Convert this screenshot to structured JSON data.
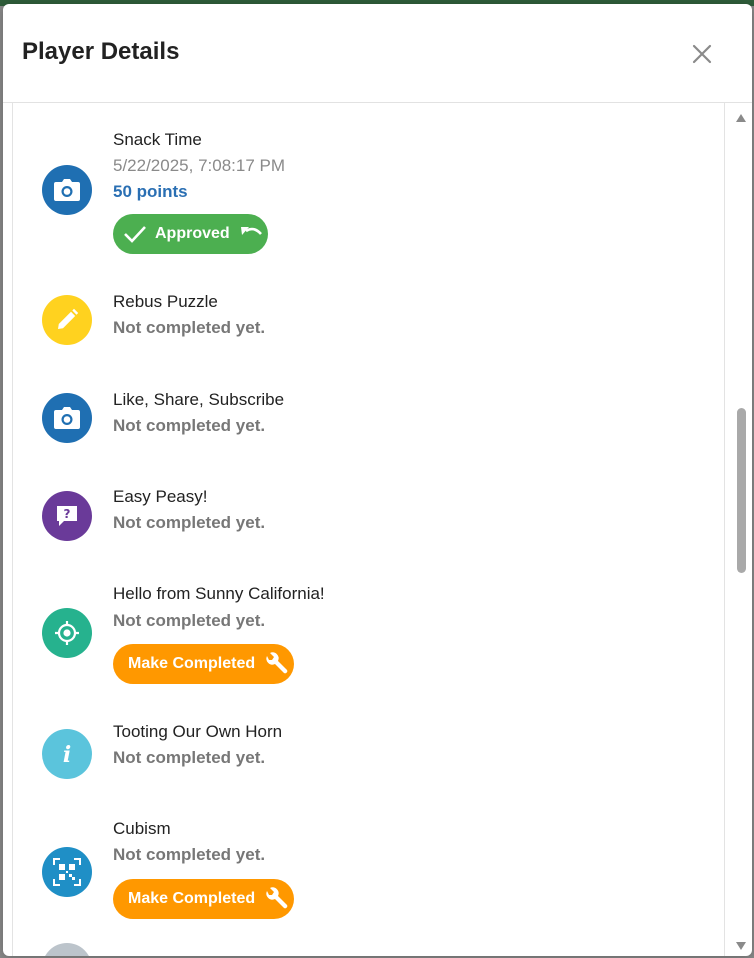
{
  "dialog": {
    "title": "Player Details"
  },
  "colors": {
    "camera": "#1f6fb2",
    "puzzle": "#ffd21f",
    "question": "#6a3a99",
    "location": "#26b28e",
    "info": "#5bc4dc",
    "qr": "#1f8fc6",
    "approved": "#4caf50",
    "make_completed": "#ff9800",
    "points": "#2a6fb3"
  },
  "items": [
    {
      "title": "Snack Time",
      "icon": "camera-icon",
      "timestamp": "5/22/2025, 7:08:17 PM",
      "points": "50 points",
      "action_label": "Approved"
    },
    {
      "title": "Rebus Puzzle",
      "icon": "pencil-icon",
      "status": "Not completed yet."
    },
    {
      "title": "Like, Share, Subscribe",
      "icon": "camera-icon",
      "status": "Not completed yet."
    },
    {
      "title": "Easy Peasy!",
      "icon": "question-bubble-icon",
      "status": "Not completed yet."
    },
    {
      "title": "Hello from Sunny California!",
      "icon": "location-target-icon",
      "status": "Not completed yet.",
      "action_label": "Make Completed"
    },
    {
      "title": "Tooting Our Own Horn",
      "icon": "info-icon",
      "status": "Not completed yet."
    },
    {
      "title": "Cubism",
      "icon": "qr-code-icon",
      "status": "Not completed yet.",
      "action_label": "Make Completed"
    }
  ]
}
